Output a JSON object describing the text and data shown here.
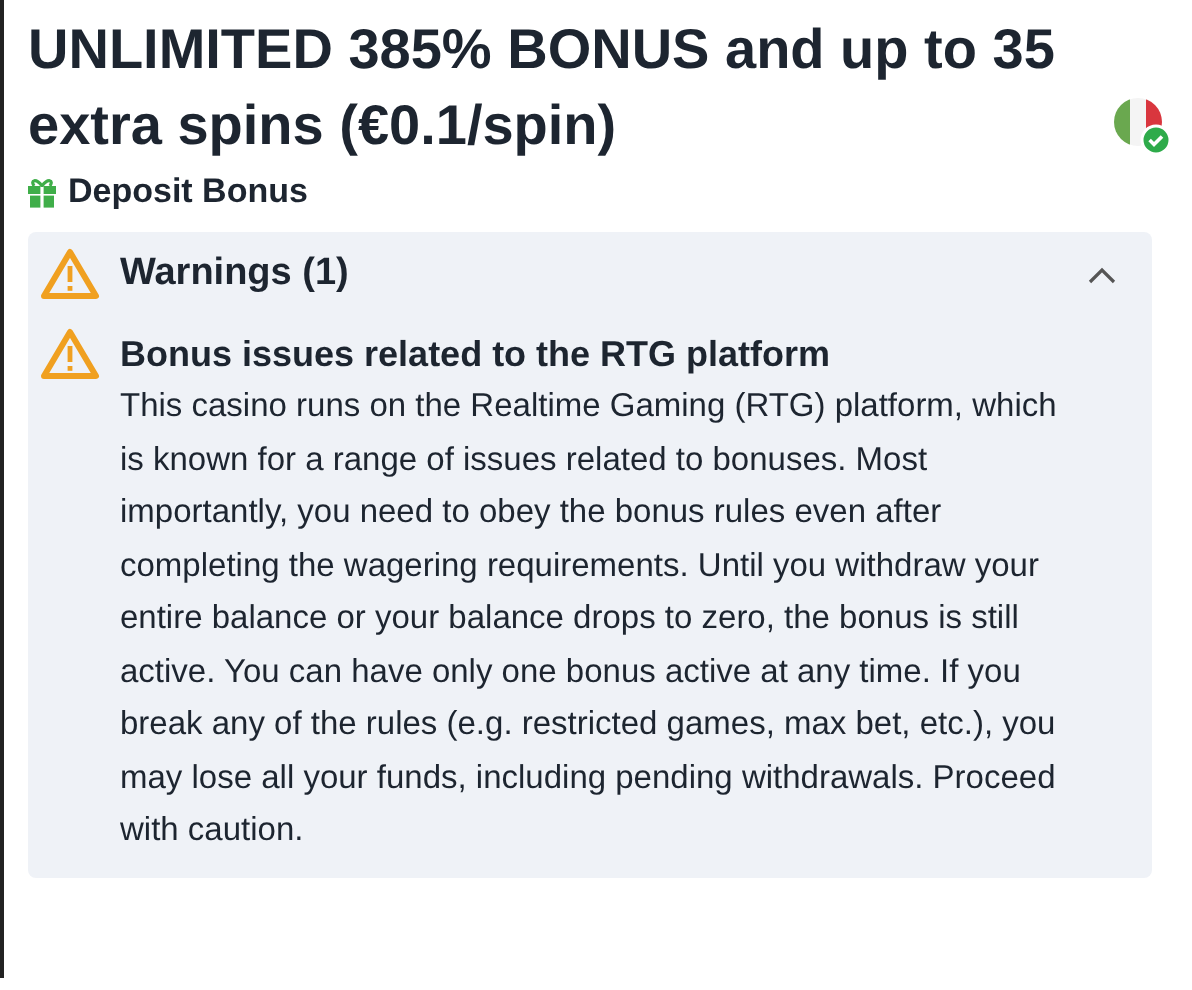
{
  "title": "UNLIMITED 385% BONUS and up to 35 extra spins (€0.1/spin)",
  "bonus_type": "Deposit Bonus",
  "warnings": {
    "title": "Warnings (1)",
    "expanded": true,
    "items": [
      {
        "heading": "Bonus issues related to the RTG platform",
        "text": "This casino runs on the Realtime Gaming (RTG) platform, which is known for a range of issues related to bonuses. Most importantly, you need to obey the bonus rules even after completing the wagering requirements. Until you withdraw your entire balance or your balance drops to zero, the bonus is still active. You can have only one bonus active at any time. If you break any of the rules (e.g. restricted games, max bet, etc.), you may lose all your funds, including pending withdrawals. Proceed with caution."
      }
    ]
  }
}
